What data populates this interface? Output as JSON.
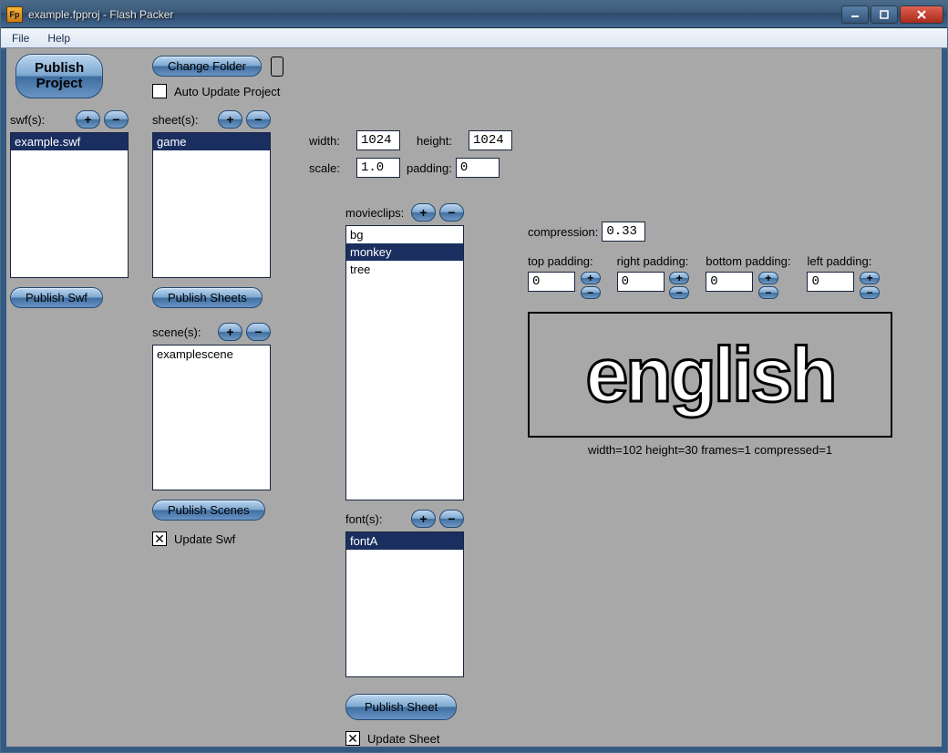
{
  "window": {
    "title": "example.fpproj - Flash Packer"
  },
  "menu": {
    "file": "File",
    "help": "Help"
  },
  "buttons": {
    "publish_project": "Publish\nProject",
    "change_folder": "Change Folder",
    "publish_swf": "Publish Swf",
    "publish_sheets": "Publish Sheets",
    "publish_scenes": "Publish Scenes",
    "publish_sheet": "Publish Sheet"
  },
  "checkboxes": {
    "auto_update": "Auto Update Project",
    "update_swf": "Update Swf",
    "update_sheet": "Update Sheet"
  },
  "labels": {
    "swfs": "swf(s):",
    "sheets": "sheet(s):",
    "scenes": "scene(s):",
    "movieclips": "movieclips:",
    "fonts": "font(s):",
    "width": "width:",
    "height": "height:",
    "scale": "scale:",
    "padding": "padding:",
    "compression": "compression:",
    "top_padding": "top padding:",
    "right_padding": "right padding:",
    "bottom_padding": "bottom padding:",
    "left_padding": "left padding:"
  },
  "lists": {
    "swfs": [
      "example.swf"
    ],
    "sheets": [
      "game"
    ],
    "scenes": [
      "examplescene"
    ],
    "movieclips": [
      "bg",
      "monkey",
      "tree"
    ],
    "fonts": [
      "fontA"
    ],
    "swfs_sel": 0,
    "sheets_sel": 0,
    "movieclips_sel": 1,
    "fonts_sel": 0
  },
  "fields": {
    "width": "1024",
    "height": "1024",
    "scale": "1.0",
    "padding": "0",
    "compression": "0.33",
    "top_padding": "0",
    "right_padding": "0",
    "bottom_padding": "0",
    "left_padding": "0"
  },
  "preview": {
    "text": "english",
    "info": "width=102 height=30 frames=1 compressed=1"
  }
}
